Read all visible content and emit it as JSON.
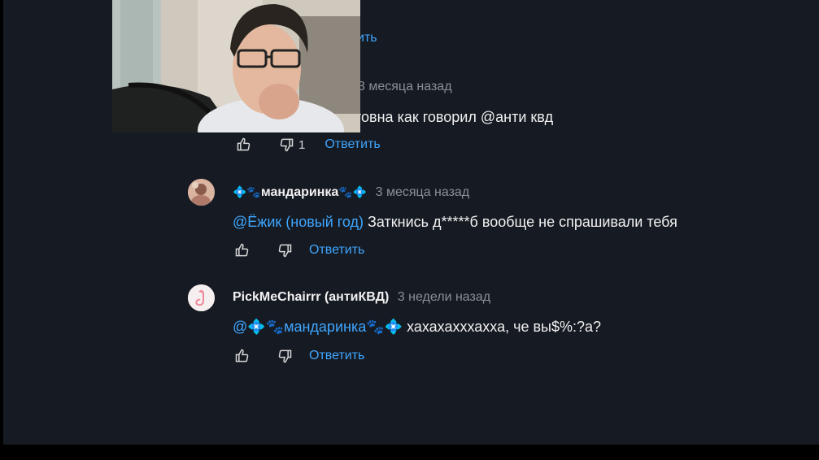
{
  "top_reply": {
    "label": "ить"
  },
  "comment0": {
    "time": "3 месяца назад",
    "text": "товна как говорил @анти квд",
    "dislike_count": "1",
    "reply": "Ответить"
  },
  "comment1": {
    "author_emoji_left": "💠🐾",
    "author": "мандаринка",
    "author_emoji_right": "🐾💠",
    "time": "3 месяца назад",
    "mention": "@Ёжик (новый год)",
    "text": " Заткнись д*****б  вообще не спрашивали тебя",
    "reply": "Ответить"
  },
  "comment2": {
    "author": "PickMeChairrr (антиКВД)",
    "time": "3 недели назад",
    "mention": "@💠🐾мандаринка🐾💠",
    "text": " хахахахххахха, че вы$%:?а?",
    "reply": "Ответить"
  },
  "icons": [
    "like-icon",
    "dislike-icon"
  ],
  "colors": {
    "background": "#161a22",
    "link": "#3ea6ff",
    "text": "#f1f1f1",
    "muted": "#8b8f96"
  }
}
